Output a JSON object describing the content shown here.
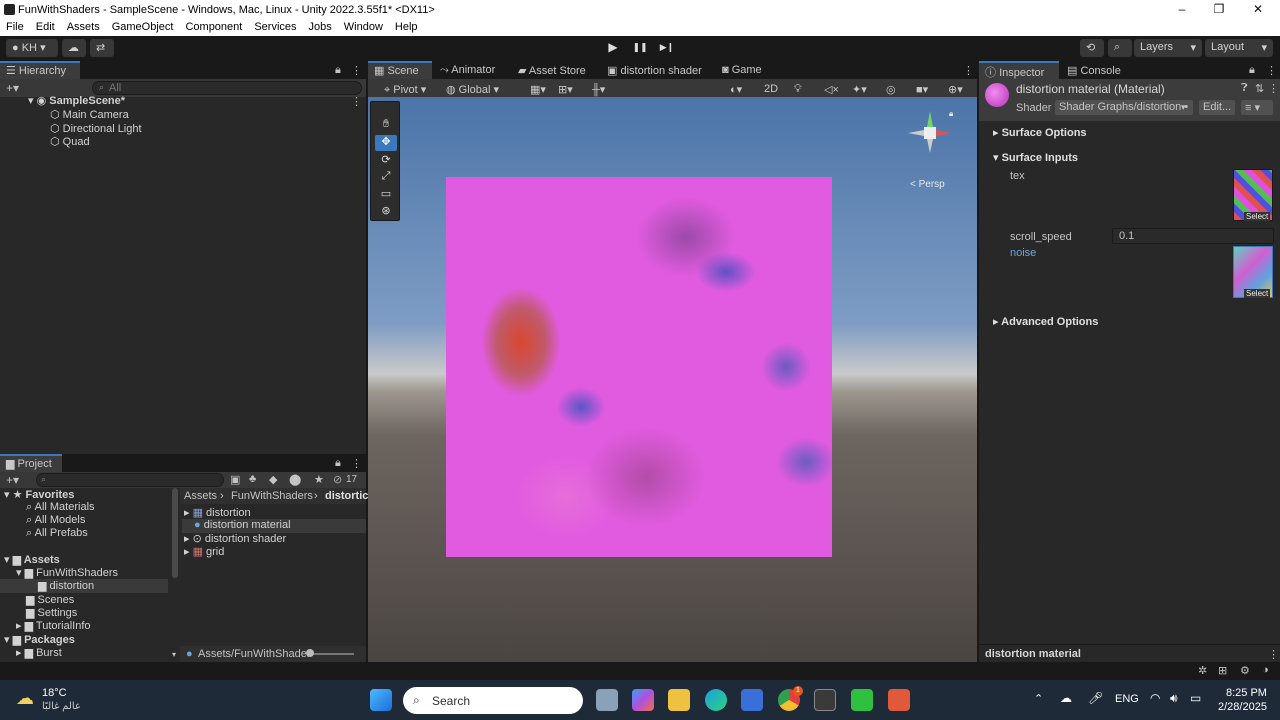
{
  "window": {
    "title": "FunWithShaders - SampleScene - Windows, Mac, Linux - Unity 2022.3.55f1* <DX11>",
    "minimize": "–",
    "maximize": "❐",
    "close": "✕"
  },
  "menu": [
    "File",
    "Edit",
    "Assets",
    "GameObject",
    "Component",
    "Services",
    "Jobs",
    "Window",
    "Help"
  ],
  "toolbar": {
    "account": "KH",
    "account_arrow": "▾",
    "layers": "Layers",
    "layout": "Layout",
    "play": "▶",
    "pause": "❚❚",
    "step": "▶❙"
  },
  "hierarchy": {
    "tab": "Hierarchy",
    "search_placeholder": "All",
    "scene": "SampleScene*",
    "items": [
      "Main Camera",
      "Directional Light",
      "Quad"
    ]
  },
  "project": {
    "tab": "Project",
    "count": "17",
    "favorites": "Favorites",
    "favorites_items": [
      "All Materials",
      "All Models",
      "All Prefabs"
    ],
    "assets": "Assets",
    "tree": [
      "FunWithShaders",
      "distortion",
      "Scenes",
      "Settings",
      "TutorialInfo"
    ],
    "packages": "Packages",
    "packages_items": [
      "Burst"
    ],
    "breadcrumb": [
      "Assets",
      "FunWithShaders",
      "distortic"
    ],
    "files": [
      "distortion",
      "distortion material",
      "distortion shader",
      "grid"
    ],
    "footer_path": "Assets/FunWithShader"
  },
  "scene_tabs": [
    "Scene",
    "Animator",
    "Asset Store",
    "distortion shader",
    "Game"
  ],
  "scene_toolbar": {
    "pivot": "Pivot",
    "global": "Global",
    "mode_2d": "2D",
    "persp": "< Persp"
  },
  "inspector": {
    "tab": "Inspector",
    "console_tab": "Console",
    "material_name": "distortion material (Material)",
    "shader_label": "Shader",
    "shader_value": "Shader Graphs/distortion •",
    "edit_button": "Edit...",
    "surface_options": "Surface Options",
    "surface_inputs": "Surface Inputs",
    "tex_label": "tex",
    "scroll_speed_label": "scroll_speed",
    "scroll_speed_value": "0.1",
    "noise_label": "noise",
    "select": "Select",
    "advanced_options": "Advanced Options",
    "footer": "distortion material"
  },
  "taskbar": {
    "temperature": "18°C",
    "weather_sub": "عالم غالبًا",
    "search_label": "Search",
    "language": "ENG",
    "time": "8:25 PM",
    "date": "2/28/2025",
    "notification_badge": "1"
  },
  "colors": {
    "accent_blue": "#3a79bb",
    "panel_bg": "#282828",
    "quad_magenta": "#e15be0"
  }
}
